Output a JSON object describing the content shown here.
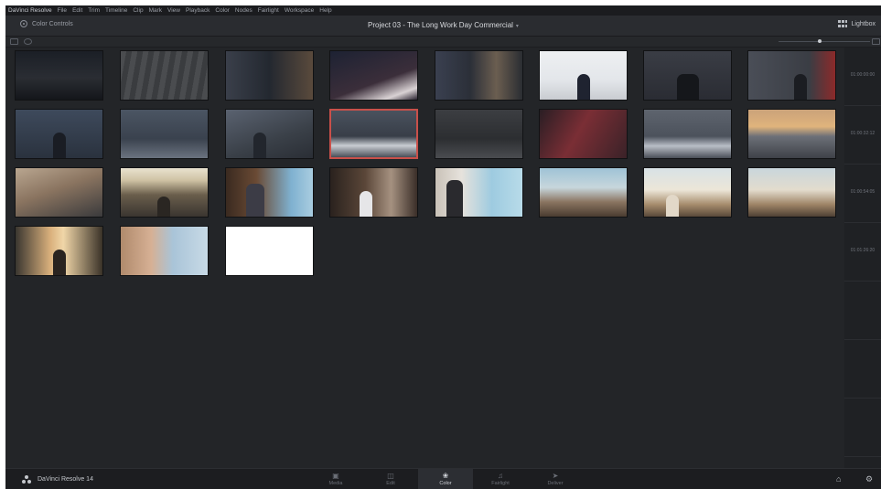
{
  "menubar": {
    "items": [
      "DaVinci Resolve",
      "File",
      "Edit",
      "Trim",
      "Timeline",
      "Clip",
      "Mark",
      "View",
      "Playback",
      "Color",
      "Nodes",
      "Fairlight",
      "Workspace",
      "Help"
    ]
  },
  "header": {
    "left_label": "Color Controls",
    "project_title": "Project 03 - The Long Work Day Commercial",
    "right_label": "Lightbox"
  },
  "timecodes": [
    "01:00:00:00",
    "01:00:32:12",
    "01:00:54:05",
    "01:01:26:20"
  ],
  "bottombar": {
    "brand": "DaVinci Resolve 14",
    "pages": [
      {
        "label": "Media",
        "icon": "media-icon",
        "active": false
      },
      {
        "label": "Edit",
        "icon": "edit-icon",
        "active": false
      },
      {
        "label": "Color",
        "icon": "color-icon",
        "active": true
      },
      {
        "label": "Fairlight",
        "icon": "fairlight-icon",
        "active": false
      },
      {
        "label": "Deliver",
        "icon": "deliver-icon",
        "active": false
      }
    ]
  },
  "accent_colors": {
    "selected_border": "#c9504a",
    "background": "#232528"
  }
}
